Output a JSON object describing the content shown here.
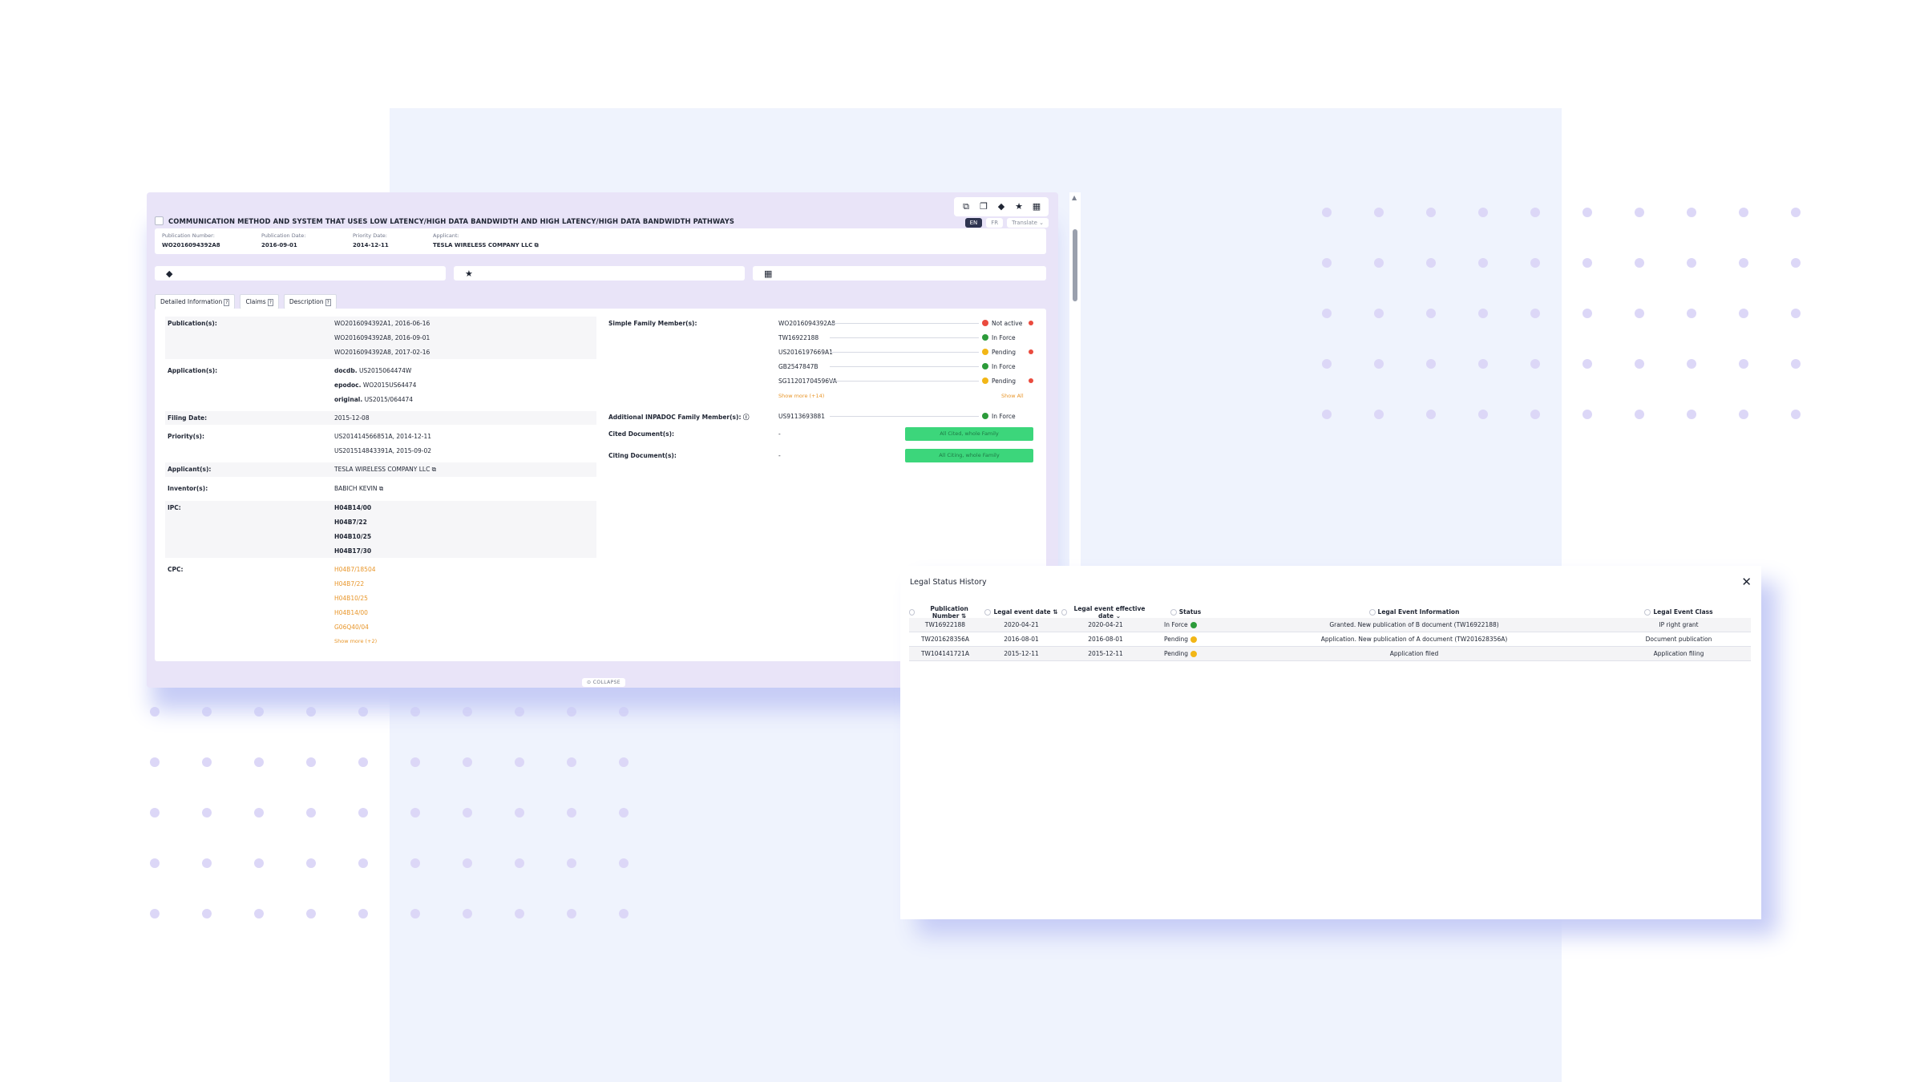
{
  "patent": {
    "title": "COMMUNICATION METHOD AND SYSTEM THAT USES LOW LATENCY/HIGH DATA BANDWIDTH AND HIGH LATENCY/HIGH DATA BANDWIDTH PATHWAYS",
    "meta": [
      {
        "label": "Publication Number:",
        "value": "WO2016094392A8"
      },
      {
        "label": "Publication Date:",
        "value": "2016-09-01"
      },
      {
        "label": "Priority Date:",
        "value": "2014-12-11"
      },
      {
        "label": "Applicant:",
        "value": "TESLA WIRELESS COMPANY LLC ⧉"
      }
    ]
  },
  "toolbar": {
    "icons": [
      "copy-icon",
      "duplicate-icon",
      "tag-icon",
      "star-icon",
      "table-icon"
    ],
    "lang_en": "EN",
    "lang_fr": "FR",
    "translate": "Translate ⌄"
  },
  "tabs": [
    {
      "label": "Detailed Information",
      "qi": "?"
    },
    {
      "label": "Claims",
      "qi": "?"
    },
    {
      "label": "Description",
      "qi": "?"
    }
  ],
  "details": {
    "publications_label": "Publication(s):",
    "publications": [
      "WO2016094392A1, 2016-06-16",
      "WO2016094392A8, 2016-09-01",
      "WO2016094392A8, 2017-02-16"
    ],
    "applications_label": "Application(s):",
    "applications": [
      {
        "prefix": "docdb.",
        "value": " US2015064474W"
      },
      {
        "prefix": "epodoc.",
        "value": " WO2015US64474"
      },
      {
        "prefix": "original.",
        "value": " US2015/064474"
      }
    ],
    "filing_label": "Filing Date:",
    "filing": "2015-12-08",
    "priorities_label": "Priority(s):",
    "priorities": [
      "US201414566851A, 2014-12-11",
      "US201514843391A, 2015-09-02"
    ],
    "applicants_label": "Applicant(s):",
    "applicants": "TESLA WIRELESS COMPANY LLC ⧉",
    "inventors_label": "Inventor(s):",
    "inventors": "BABICH KEVIN ⧉",
    "ipc_label": "IPC:",
    "ipc": [
      "H04B14/00",
      "H04B7/22",
      "H04B10/25",
      "H04B17/30"
    ],
    "cpc_label": "CPC:",
    "cpc": [
      "H04B7/18504",
      "H04B7/22",
      "H04B10/25",
      "H04B14/00",
      "G06Q40/04"
    ],
    "cpc_more": "Show more (+2)"
  },
  "family": {
    "simple_label": "Simple Family Member(s):",
    "members": [
      {
        "number": "WO2016094392A8",
        "status": "Not active",
        "color": "#ea4b3e",
        "flag": true
      },
      {
        "number": "TW16922188",
        "status": "In Force",
        "color": "#2c9b3a",
        "flag": false
      },
      {
        "number": "US2016197669A1",
        "status": "Pending",
        "color": "#f2b616",
        "flag": true
      },
      {
        "number": "GB2547847B",
        "status": "In Force",
        "color": "#2c9b3a",
        "flag": false
      },
      {
        "number": "SG11201704596VA",
        "status": "Pending",
        "color": "#f2b616",
        "flag": true
      }
    ],
    "show_more": "Show more (+14)",
    "show_all": "Show All",
    "inpadoc_label": "Additional INPADOC Family Member(s): ⓘ",
    "inpadoc": {
      "number": "US9113693881",
      "status": "In Force",
      "color": "#2c9b3a"
    },
    "cited_label": "Cited Document(s):",
    "cited_value": "-",
    "cited_button": "All Cited, whole Family",
    "citing_label": "Citing Document(s):",
    "citing_value": "-",
    "citing_button": "All Citing, whole Family"
  },
  "collapse_label": "⊙ COLLAPSE",
  "legal": {
    "title": "Legal Status History",
    "close": "✕",
    "headers": [
      "Publication Number ⇅",
      "Legal event date ⇅",
      "Legal event effective date ⌄",
      "Status",
      "Legal Event Information",
      "Legal Event Class"
    ],
    "rows": [
      {
        "pub": "TW16922188",
        "date": "2020-04-21",
        "eff": "2020-04-21",
        "status": "In Force",
        "color": "#2c9b3a",
        "info": "Granted. New publication of B document (TW16922188)",
        "class": "IP right grant"
      },
      {
        "pub": "TW201628356A",
        "date": "2016-08-01",
        "eff": "2016-08-01",
        "status": "Pending",
        "color": "#f2b616",
        "info": "Application. New publication of A document (TW201628356A)",
        "class": "Document publication"
      },
      {
        "pub": "TW104141721A",
        "date": "2015-12-11",
        "eff": "2015-12-11",
        "status": "Pending",
        "color": "#f2b616",
        "info": "Application filed",
        "class": "Application filing"
      }
    ]
  }
}
